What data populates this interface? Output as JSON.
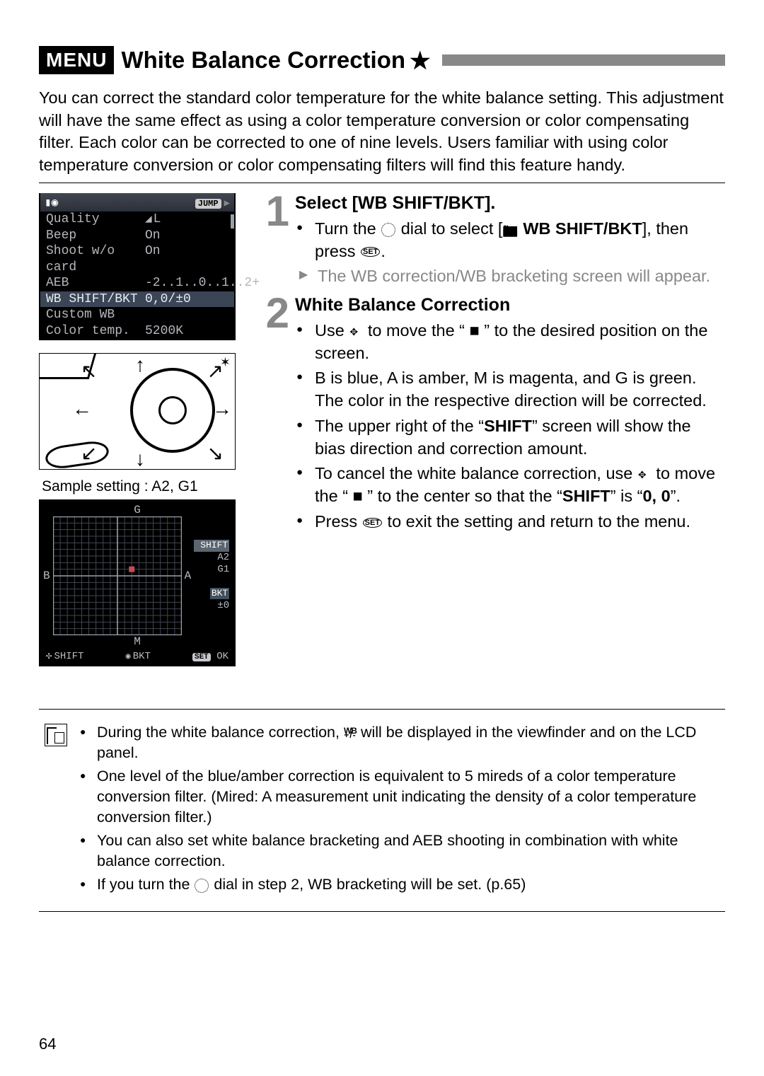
{
  "header": {
    "menu_badge": "MENU",
    "title": "White Balance Correction",
    "star": "★"
  },
  "intro": "You can correct the standard color temperature for the white balance setting. This adjustment will have the same effect as using a color temperature conversion or color compensating filter. Each color can be corrected to one of nine levels. Users familiar with using color temperature conversion or color compensating filters will find this feature handy.",
  "cam_menu": {
    "jump": "JUMP",
    "rows": [
      {
        "label": "Quality",
        "value_icon": "◢",
        "value_text": "L"
      },
      {
        "label": "Beep",
        "value": "On"
      },
      {
        "label": "Shoot w/o card",
        "value": "On"
      },
      {
        "label": "AEB",
        "value": "-2..1..0..1..2+"
      },
      {
        "label": "WB SHIFT/BKT",
        "value": "0,0/±0",
        "selected": true
      },
      {
        "label": "Custom WB",
        "value": ""
      },
      {
        "label": "Color temp.",
        "value": "5200K"
      }
    ]
  },
  "sample_label": "Sample setting : A2, G1",
  "wb_grid": {
    "g": "G",
    "m": "M",
    "b": "B",
    "a": "A",
    "shift_label": "SHIFT",
    "shift_a": "A2",
    "shift_g": "G1",
    "bkt_label": "BKT",
    "bkt_val": "±0",
    "bottom_shift": "SHIFT",
    "bottom_bkt": "BKT",
    "set": "SET",
    "ok": "OK",
    "marker": {
      "col": 11,
      "row": 8
    }
  },
  "steps": [
    {
      "num": "1",
      "title": "Select [WB SHIFT/BKT].",
      "bullets": [
        {
          "html": "Turn the <__DIAL__> dial to select [<__CAM__> <b>WB SHIFT/BKT</b>], then press <__SET__>."
        },
        {
          "tri": true,
          "html": "The WB correction/WB bracketing screen will appear."
        }
      ]
    },
    {
      "num": "2",
      "title": "White Balance Correction",
      "bullets": [
        {
          "html": "Use <__MULTI__> to move the “ ■ ” to the desired position on the screen."
        },
        {
          "html": "B is blue, A is amber, M is magenta, and G is green. The color in the respective direction will be corrected."
        },
        {
          "html": "The upper right of the “<b>SHIFT</b>” screen will show the bias direction and correction amount."
        },
        {
          "html": "To cancel the white balance correction, use <__MULTI__> to move the “ ■ ” to the center so that the “<b>SHIFT</b>” is “<b>0, 0</b>”."
        },
        {
          "html": "Press <__SET__> to exit the setting and return to the menu."
        }
      ]
    }
  ],
  "notes": [
    {
      "html": "During the white balance correction, <__WBPM__> will be displayed in the viewfinder and on the LCD panel."
    },
    {
      "html": "One level of the blue/amber correction is equivalent to 5 mireds of a color temperature conversion filter. (Mired: A measurement unit indicating the density of a color temperature conversion filter.)"
    },
    {
      "html": "You can also set white balance bracketing and AEB shooting in combination with white balance correction."
    },
    {
      "html": "If you turn the <__DIAL__> dial in step 2, WB bracketing will be set. (p.65)"
    }
  ],
  "page_number": "64"
}
